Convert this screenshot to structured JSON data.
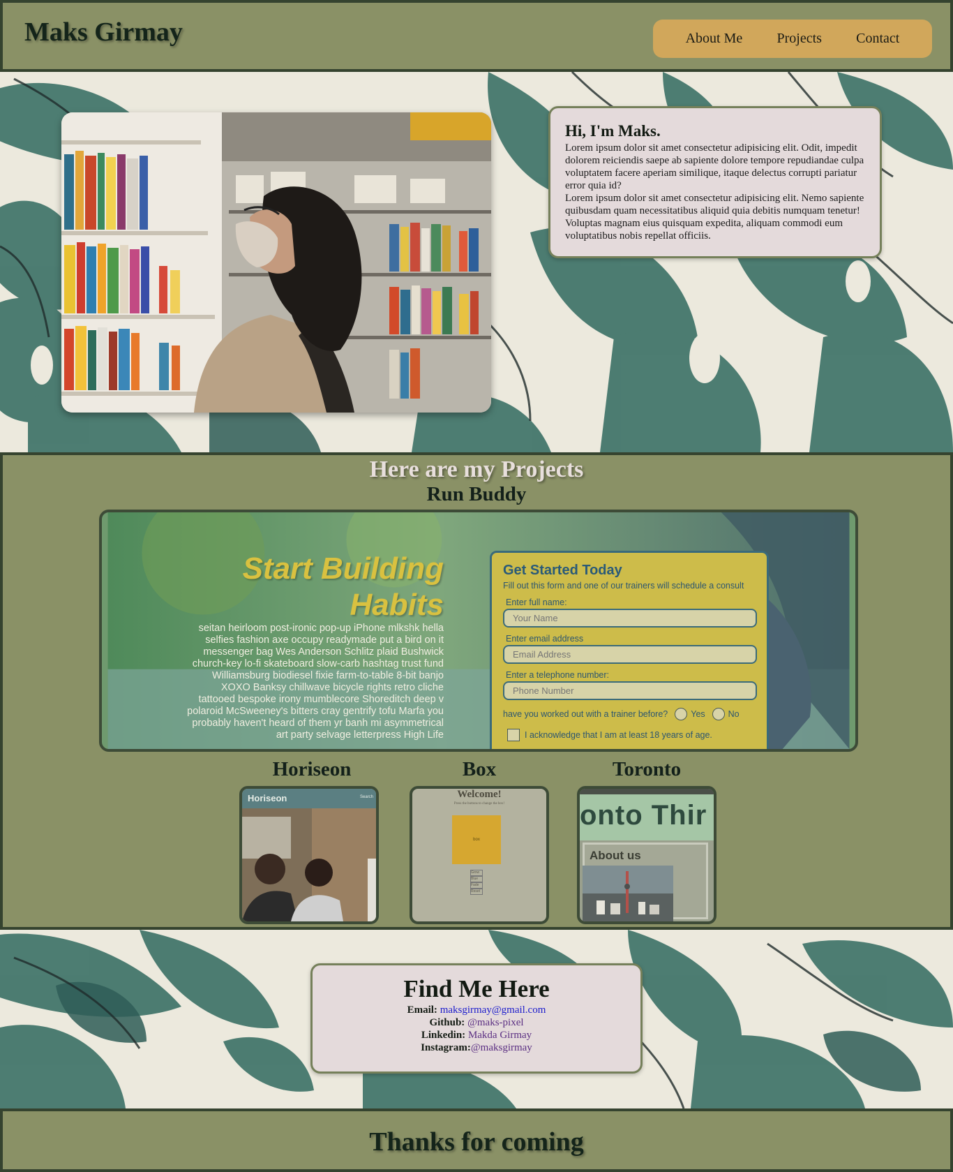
{
  "header": {
    "brand": "Maks Girmay",
    "nav": [
      "About Me",
      "Projects",
      "Contact"
    ]
  },
  "about": {
    "title": "Hi, I'm Maks.",
    "paragraph1": "Lorem ipsum dolor sit amet consectetur adipisicing elit. Odit, impedit dolorem reiciendis saepe ab sapiente dolore tempore repudiandae culpa voluptatem facere aperiam similique, itaque delectus corrupti pariatur error quia id?",
    "paragraph2": "Lorem ipsum dolor sit amet consectetur adipisicing elit. Nemo sapiente quibusdam quam necessitatibus aliquid quia debitis numquam tenetur! Voluptas magnam eius quisquam expedita, aliquam commodi eum voluptatibus nobis repellat officiis."
  },
  "projects": {
    "title": "Here are my Projects",
    "featured": {
      "name": "Run Buddy",
      "headline1": "Start Building",
      "headline2": "Habits",
      "copy": "seitan heirloom post-ironic pop-up iPhone mlkshk hella selfies fashion axe occupy readymade put a bird on it messenger bag Wes Anderson Schlitz plaid Bushwick church-key lo-fi skateboard slow-carb hashtag trust fund Williamsburg biodiesel fixie farm-to-table 8-bit banjo XOXO Banksy chillwave bicycle rights retro cliche tattooed bespoke irony mumblecore Shoreditch deep v polaroid McSweeney's bitters cray gentrify tofu Marfa you probably haven't heard of them yr banh mi asymmetrical art party selvage letterpress High Life",
      "form": {
        "title": "Get Started Today",
        "subtitle": "Fill out this form and one of our trainers will schedule a consult",
        "name_label": "Enter full name:",
        "name_placeholder": "Your Name",
        "email_label": "Enter email address",
        "email_placeholder": "Email Address",
        "phone_label": "Enter a telephone number:",
        "phone_placeholder": "Phone Number",
        "trainer_question": "have you worked out with a trainer before?",
        "yes": "Yes",
        "no": "No",
        "ack": "I acknowledge that I am at least 18 years of age."
      }
    },
    "others": [
      {
        "name": "Horiseon",
        "thumb_title": "Horiseon",
        "thumb_nav": "Search"
      },
      {
        "name": "Box",
        "thumb_title": "Welcome!",
        "thumb_sub": "Press the buttons to change the box!",
        "box_label": "box",
        "buttons": [
          "Grow",
          "Blue",
          "Fade",
          "Reset"
        ]
      },
      {
        "name": "Toronto",
        "thumb_title": "onto Thir",
        "thumb_section": "About us"
      }
    ]
  },
  "contact": {
    "title": "Find Me Here",
    "email_label": "Email:",
    "email": "maksgirmay@gmail.com",
    "github_label": "Github:",
    "github": "@maks-pixel",
    "linkedin_label": "Linkedin:",
    "linkedin": "Makda Girmay",
    "instagram_label": "Instagram:",
    "instagram": "@maksgirmay"
  },
  "footer": {
    "text": "Thanks for coming"
  },
  "colors": {
    "olive": "#8a9166",
    "dark_border": "#35432f",
    "nav_bg": "#d1a75b",
    "card_bg": "#e4dadb",
    "leaf_green": "#3f7368"
  }
}
